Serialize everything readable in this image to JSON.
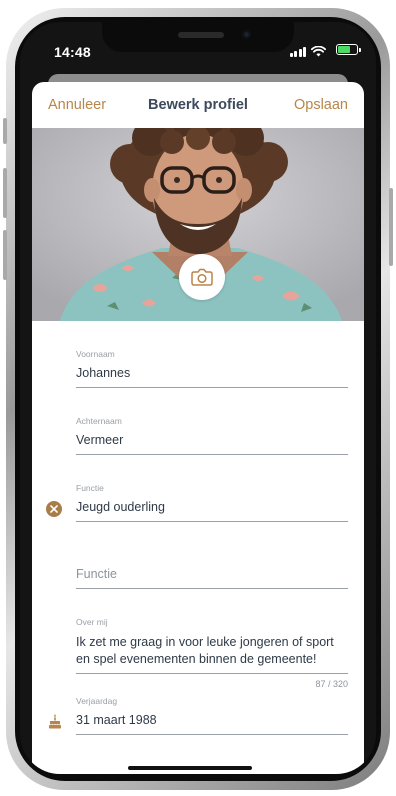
{
  "status": {
    "time": "14:48"
  },
  "nav": {
    "cancel": "Annuleer",
    "title": "Bewerk profiel",
    "save": "Opslaan"
  },
  "form": {
    "first_name": {
      "label": "Voornaam",
      "value": "Johannes"
    },
    "last_name": {
      "label": "Achternaam",
      "value": "Vermeer"
    },
    "function_1": {
      "label": "Functie",
      "value": "Jeugd ouderling"
    },
    "function_2": {
      "placeholder": "Functie"
    },
    "about": {
      "label": "Over mij",
      "value": "Ik zet me graag in voor leuke jongeren of sport en spel evenementen binnen de gemeente!",
      "counter": "87 / 320"
    },
    "birthday": {
      "label": "Verjaardag",
      "value": "31 maart 1988"
    }
  },
  "colors": {
    "accent": "#b8864a",
    "title": "#3d4a5c",
    "line": "#9aa0a6"
  },
  "icons": {
    "photo": "camera-icon",
    "remove": "clear-icon",
    "birthday": "cake-icon"
  }
}
